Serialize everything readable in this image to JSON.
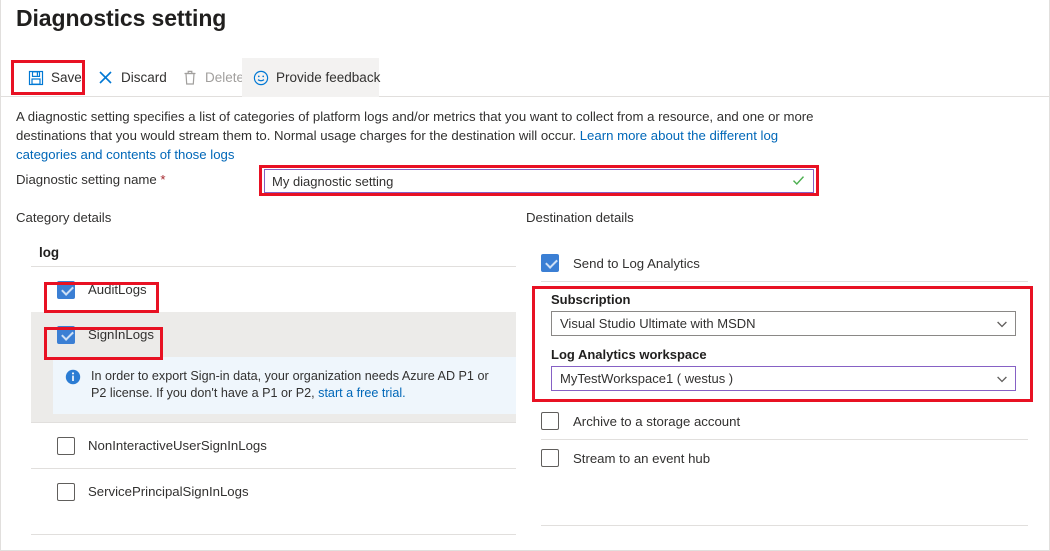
{
  "page": {
    "title": "Diagnostics setting"
  },
  "toolbar": {
    "save_label": "Save",
    "discard_label": "Discard",
    "delete_label": "Delete",
    "feedback_label": "Provide feedback",
    "icons": {
      "save": "save-icon",
      "discard": "close-x-icon",
      "delete": "trash-icon",
      "feedback": "smiley-icon"
    }
  },
  "description": {
    "text_part1": "A diagnostic setting specifies a list of categories of platform logs and/or metrics that you want to collect from a resource, and one or more destinations that you would stream them to. Normal usage charges for the destination will occur. ",
    "link_text": "Learn more about the different log categories and contents of those logs"
  },
  "name_row": {
    "label": "Diagnostic setting name",
    "required_marker": "*",
    "value": "My diagnostic setting",
    "placeholder": "My diagnostic setting",
    "valid_icon": "checkmark-icon"
  },
  "category": {
    "header": "Category details",
    "group_title": "log",
    "items": [
      {
        "label": "AuditLogs",
        "checked": true,
        "highlighted": true,
        "shaded": false
      },
      {
        "label": "SignInLogs",
        "checked": true,
        "highlighted": true,
        "shaded": true
      },
      {
        "label": "NonInteractiveUserSignInLogs",
        "checked": false,
        "highlighted": false,
        "shaded": false
      },
      {
        "label": "ServicePrincipalSignInLogs",
        "checked": false,
        "highlighted": false,
        "shaded": false
      }
    ],
    "info": {
      "icon": "info-icon",
      "text_part1": "In order to export Sign-in data, your organization needs Azure AD P1 or P2 license. If you don't have a P1 or P2, ",
      "link_text": "start a free trial."
    }
  },
  "destination": {
    "header": "Destination details",
    "log_analytics": {
      "label": "Send to Log Analytics",
      "checked": true
    },
    "subscription": {
      "label": "Subscription",
      "value": "Visual Studio Ultimate with MSDN",
      "focused": false
    },
    "workspace": {
      "label": "Log Analytics workspace",
      "value": "MyTestWorkspace1 ( westus )",
      "focused": true
    },
    "storage": {
      "label": "Archive to a storage account",
      "checked": false
    },
    "eventhub": {
      "label": "Stream to an event hub",
      "checked": false
    }
  },
  "colors": {
    "annotation_red": "#e81123",
    "link_blue": "#0067b8",
    "checkbox_blue": "#3b7fd4",
    "focus_purple": "#8661c5",
    "valid_green": "#4caf50",
    "info_bg": "#eff6fc",
    "row_shade": "#ecebe9"
  }
}
